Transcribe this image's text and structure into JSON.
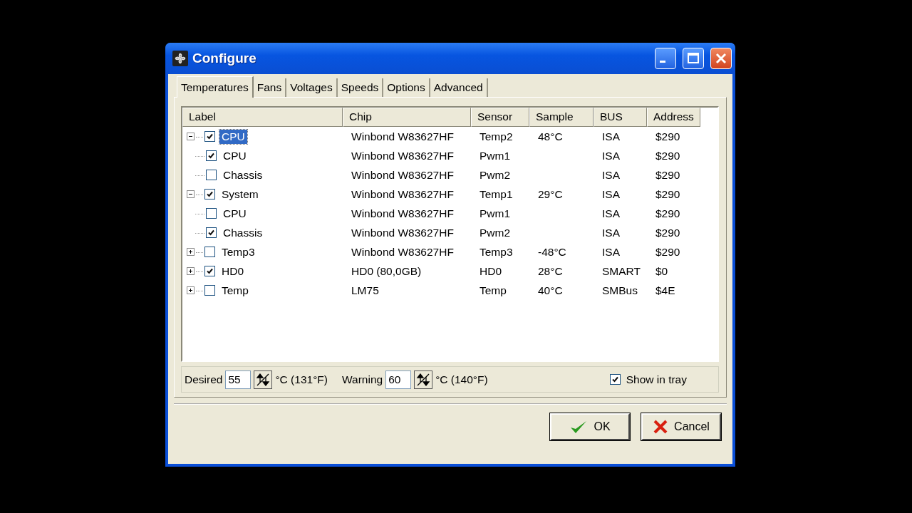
{
  "window": {
    "title": "Configure"
  },
  "tabs": [
    {
      "label": "Temperatures",
      "selected": true
    },
    {
      "label": "Fans",
      "selected": false
    },
    {
      "label": "Voltages",
      "selected": false
    },
    {
      "label": "Speeds",
      "selected": false
    },
    {
      "label": "Options",
      "selected": false
    },
    {
      "label": "Advanced",
      "selected": false
    }
  ],
  "tree": {
    "columns": [
      "Label",
      "Chip",
      "Sensor",
      "Sample",
      "BUS",
      "Address"
    ],
    "rows": [
      {
        "label": "CPU",
        "checked": true,
        "selected": true,
        "expanded": true,
        "chip": "Winbond W83627HF",
        "sensor": "Temp2",
        "sample": "48°C",
        "bus": "ISA",
        "address": "$290",
        "children": [
          {
            "label": "CPU",
            "checked": true,
            "selected": false,
            "chip": "Winbond W83627HF",
            "sensor": "Pwm1",
            "bus": "ISA",
            "address": "$290"
          },
          {
            "label": "Chassis",
            "checked": false,
            "selected": false,
            "chip": "Winbond W83627HF",
            "sensor": "Pwm2",
            "bus": "ISA",
            "address": "$290"
          }
        ]
      },
      {
        "label": "System",
        "checked": true,
        "selected": false,
        "expanded": true,
        "chip": "Winbond W83627HF",
        "sensor": "Temp1",
        "sample": "29°C",
        "bus": "ISA",
        "address": "$290",
        "children": [
          {
            "label": "CPU",
            "checked": false,
            "selected": false,
            "chip": "Winbond W83627HF",
            "sensor": "Pwm1",
            "bus": "ISA",
            "address": "$290"
          },
          {
            "label": "Chassis",
            "checked": true,
            "selected": false,
            "chip": "Winbond W83627HF",
            "sensor": "Pwm2",
            "bus": "ISA",
            "address": "$290"
          }
        ]
      },
      {
        "label": "Temp3",
        "checked": false,
        "selected": false,
        "expanded": false,
        "chip": "Winbond W83627HF",
        "sensor": "Temp3",
        "sample": "-48°C",
        "bus": "ISA",
        "address": "$290"
      },
      {
        "label": "HD0",
        "checked": true,
        "selected": false,
        "expanded": false,
        "chip": "HD0 (80,0GB)",
        "sensor": "HD0",
        "sample": "28°C",
        "bus": "SMART",
        "address": "$0"
      },
      {
        "label": "Temp",
        "checked": false,
        "selected": false,
        "expanded": false,
        "chip": "LM75",
        "sensor": "Temp",
        "sample": "40°C",
        "bus": "SMBus",
        "address": "$4E"
      }
    ]
  },
  "limits": {
    "desired_label": "Desired",
    "desired_value": "55",
    "desired_unit": "°C (131°F)",
    "warning_label": "Warning",
    "warning_value": "60",
    "warning_unit": "°C (140°F)",
    "show_in_tray": {
      "label": "Show in tray",
      "checked": true
    }
  },
  "buttons": [
    {
      "kind": "ok",
      "label": "OK"
    },
    {
      "kind": "cancel",
      "label": "Cancel"
    }
  ]
}
